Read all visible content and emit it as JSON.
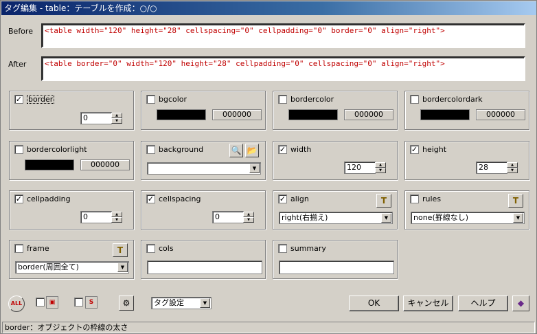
{
  "title": "タグ編集 - table：テーブルを作成：○/○",
  "before": {
    "label": "Before",
    "code": "<table width=\"120\" height=\"28\" cellspacing=\"0\" cellpadding=\"0\" border=\"0\" align=\"right\">"
  },
  "after": {
    "label": "After",
    "code": "<table border=\"0\" width=\"120\" height=\"28\" cellpadding=\"0\" cellspacing=\"0\" align=\"right\">"
  },
  "groups": {
    "border": {
      "label": "border",
      "checked": "✓",
      "value": "0"
    },
    "bgcolor": {
      "label": "bgcolor",
      "checked": "",
      "hex": "000000"
    },
    "bordercolor": {
      "label": "bordercolor",
      "checked": "",
      "hex": "000000"
    },
    "bordercolordark": {
      "label": "bordercolordark",
      "checked": "",
      "hex": "000000"
    },
    "bordercolorlight": {
      "label": "bordercolorlight",
      "checked": "",
      "hex": "000000"
    },
    "background": {
      "label": "background",
      "checked": "",
      "value": ""
    },
    "width": {
      "label": "width",
      "checked": "✓",
      "value": "120"
    },
    "height": {
      "label": "height",
      "checked": "✓",
      "value": "28"
    },
    "cellpadding": {
      "label": "cellpadding",
      "checked": "✓",
      "value": "0"
    },
    "cellspacing": {
      "label": "cellspacing",
      "checked": "✓",
      "value": "0"
    },
    "align": {
      "label": "align",
      "checked": "✓",
      "value": "right(右揃え)"
    },
    "rules": {
      "label": "rules",
      "checked": "",
      "value": "none(罫線なし)"
    },
    "frame": {
      "label": "frame",
      "checked": "",
      "value": "border(周囲全て)"
    },
    "cols": {
      "label": "cols",
      "checked": "",
      "value": ""
    },
    "summary": {
      "label": "summary",
      "checked": "",
      "value": ""
    }
  },
  "bottom": {
    "tag_select": "タグ設定",
    "ok_label": "OK",
    "cancel_label": "キャンセル",
    "help_label": "ヘルプ"
  },
  "status": "border：オブジェクトの枠線の太さ"
}
